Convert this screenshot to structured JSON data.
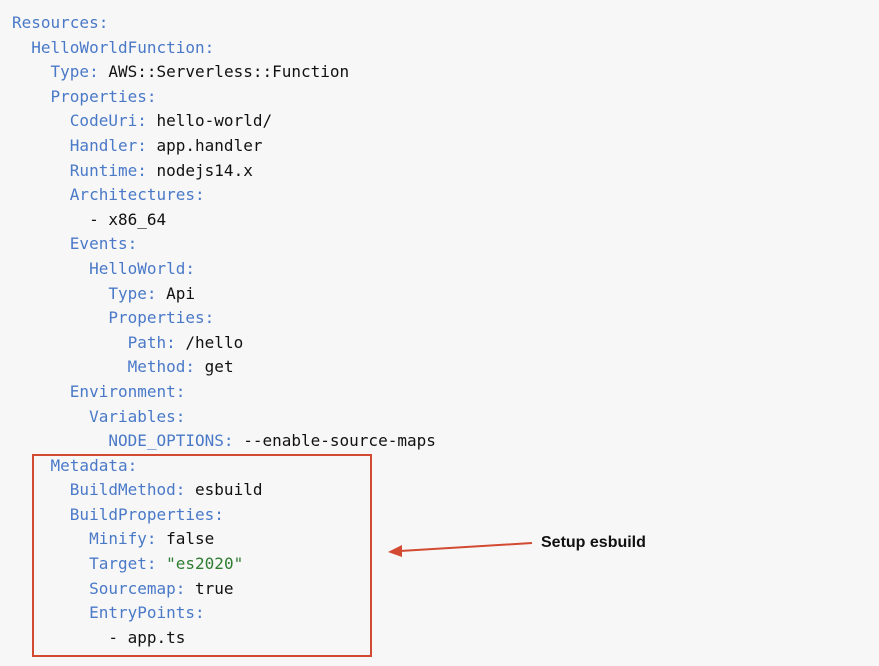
{
  "yaml_lines": [
    {
      "indent": 0,
      "key": "Resources:",
      "value": "",
      "value_type": "plain"
    },
    {
      "indent": 1,
      "key": "HelloWorldFunction:",
      "value": "",
      "value_type": "plain"
    },
    {
      "indent": 2,
      "key": "Type:",
      "value": "AWS::Serverless::Function",
      "value_type": "plain"
    },
    {
      "indent": 2,
      "key": "Properties:",
      "value": "",
      "value_type": "plain"
    },
    {
      "indent": 3,
      "key": "CodeUri:",
      "value": "hello-world/",
      "value_type": "plain"
    },
    {
      "indent": 3,
      "key": "Handler:",
      "value": "app.handler",
      "value_type": "plain"
    },
    {
      "indent": 3,
      "key": "Runtime:",
      "value": "nodejs14.x",
      "value_type": "plain"
    },
    {
      "indent": 3,
      "key": "Architectures:",
      "value": "",
      "value_type": "plain"
    },
    {
      "indent": 4,
      "key": "",
      "value": "- x86_64",
      "value_type": "plain"
    },
    {
      "indent": 3,
      "key": "Events:",
      "value": "",
      "value_type": "plain"
    },
    {
      "indent": 4,
      "key": "HelloWorld:",
      "value": "",
      "value_type": "plain"
    },
    {
      "indent": 5,
      "key": "Type:",
      "value": "Api",
      "value_type": "plain"
    },
    {
      "indent": 5,
      "key": "Properties:",
      "value": "",
      "value_type": "plain"
    },
    {
      "indent": 6,
      "key": "Path:",
      "value": "/hello",
      "value_type": "plain"
    },
    {
      "indent": 6,
      "key": "Method:",
      "value": "get",
      "value_type": "plain"
    },
    {
      "indent": 3,
      "key": "Environment:",
      "value": "",
      "value_type": "plain"
    },
    {
      "indent": 4,
      "key": "Variables:",
      "value": "",
      "value_type": "plain"
    },
    {
      "indent": 5,
      "key": "NODE_OPTIONS:",
      "value": "--enable-source-maps",
      "value_type": "plain"
    },
    {
      "indent": 2,
      "key": "Metadata:",
      "value": "",
      "value_type": "plain"
    },
    {
      "indent": 3,
      "key": "BuildMethod:",
      "value": "esbuild",
      "value_type": "plain"
    },
    {
      "indent": 3,
      "key": "BuildProperties:",
      "value": "",
      "value_type": "plain"
    },
    {
      "indent": 4,
      "key": "Minify:",
      "value": "false",
      "value_type": "plain"
    },
    {
      "indent": 4,
      "key": "Target:",
      "value": "\"es2020\"",
      "value_type": "string"
    },
    {
      "indent": 4,
      "key": "Sourcemap:",
      "value": "true",
      "value_type": "plain"
    },
    {
      "indent": 4,
      "key": "EntryPoints:",
      "value": "",
      "value_type": "plain"
    },
    {
      "indent": 5,
      "key": "",
      "value": "- app.ts",
      "value_type": "plain"
    }
  ],
  "annotation": {
    "label": "Setup esbuild"
  },
  "colors": {
    "key": "#4a79c8",
    "value": "#111111",
    "string": "#2e7d32",
    "highlight": "#d24a32",
    "background": "#f7f7f7"
  }
}
